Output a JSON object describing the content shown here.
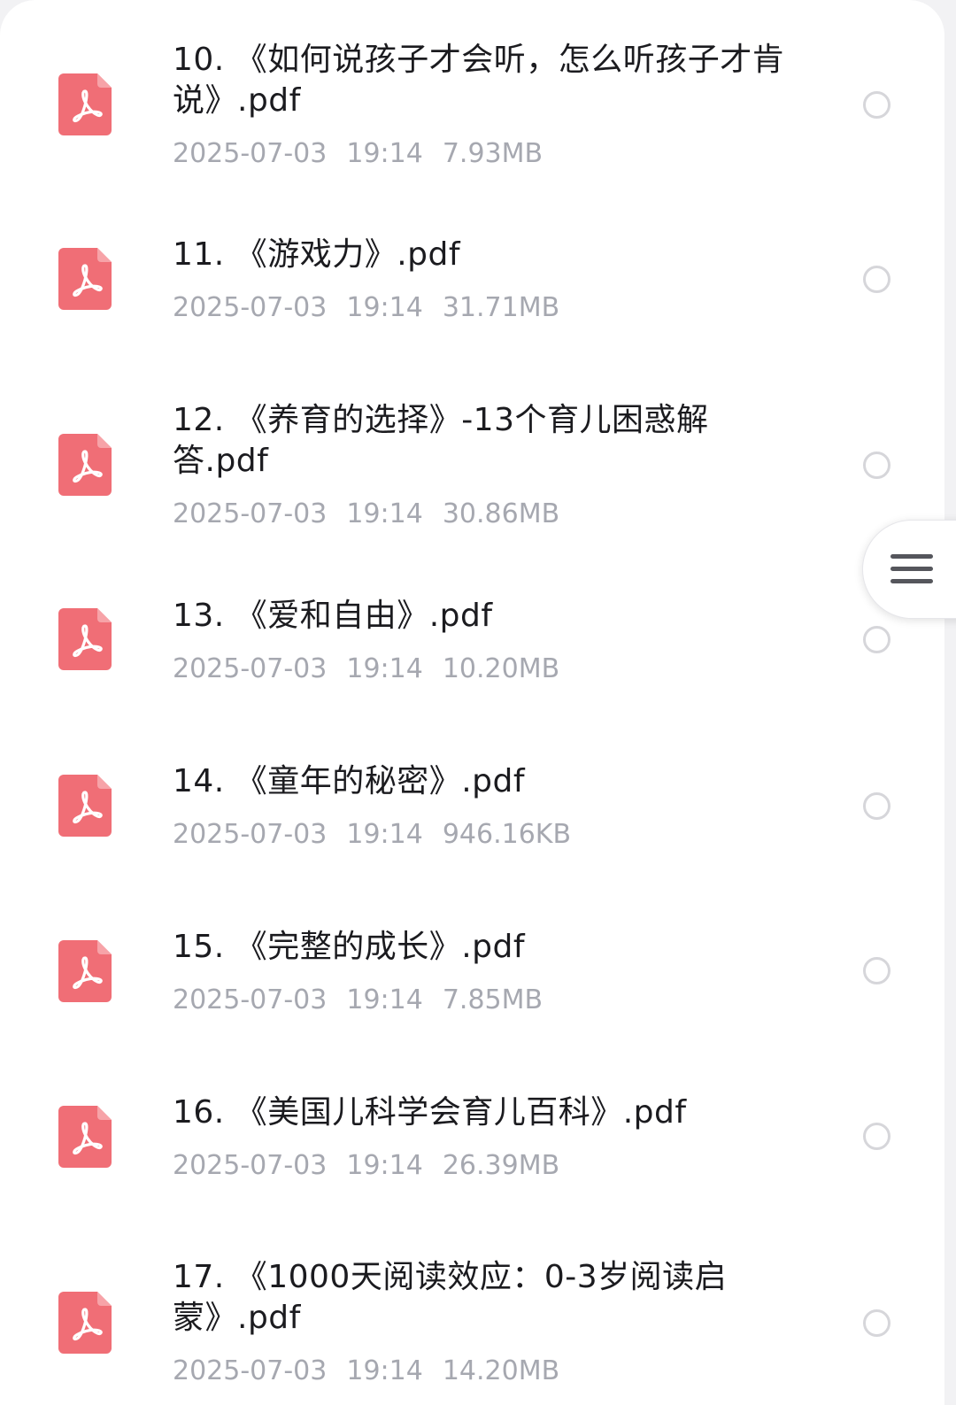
{
  "colors": {
    "pdf_icon": "#f06e76",
    "title_text": "#1b1b1f",
    "meta_text": "#a6a8b0",
    "radio_border": "#d6d6da"
  },
  "files": [
    {
      "name": "10. 《如何说孩子才会听，怎么听孩子才肯说》.pdf",
      "date": "2025-07-03",
      "time": "19:14",
      "size": "7.93MB",
      "icon": "pdf-icon",
      "selected": false
    },
    {
      "name": "11. 《游戏力》.pdf",
      "date": "2025-07-03",
      "time": "19:14",
      "size": "31.71MB",
      "icon": "pdf-icon",
      "selected": false
    },
    {
      "name": "12. 《养育的选择》-13个育儿困惑解答.pdf",
      "date": "2025-07-03",
      "time": "19:14",
      "size": "30.86MB",
      "icon": "pdf-icon",
      "selected": false
    },
    {
      "name": "13. 《爱和自由》.pdf",
      "date": "2025-07-03",
      "time": "19:14",
      "size": "10.20MB",
      "icon": "pdf-icon",
      "selected": false
    },
    {
      "name": "14. 《童年的秘密》.pdf",
      "date": "2025-07-03",
      "time": "19:14",
      "size": "946.16KB",
      "icon": "pdf-icon",
      "selected": false
    },
    {
      "name": "15. 《完整的成长》.pdf",
      "date": "2025-07-03",
      "time": "19:14",
      "size": "7.85MB",
      "icon": "pdf-icon",
      "selected": false
    },
    {
      "name": "16. 《美国儿科学会育儿百科》.pdf",
      "date": "2025-07-03",
      "time": "19:14",
      "size": "26.39MB",
      "icon": "pdf-icon",
      "selected": false
    },
    {
      "name": "17. 《1000天阅读效应：0-3岁阅读启蒙》.pdf",
      "date": "2025-07-03",
      "time": "19:14",
      "size": "14.20MB",
      "icon": "pdf-icon",
      "selected": false
    }
  ],
  "floating_menu": {
    "icon": "menu-icon"
  }
}
